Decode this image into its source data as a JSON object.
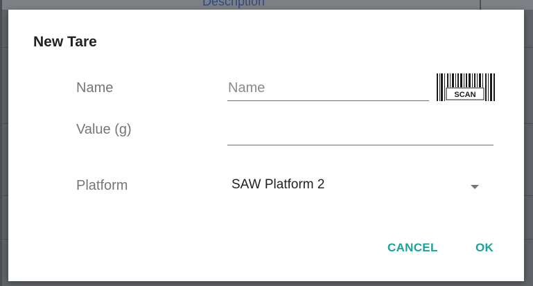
{
  "background": {
    "header_text": "Description"
  },
  "dialog": {
    "title": "New Tare",
    "fields": {
      "name": {
        "label": "Name",
        "value": "",
        "placeholder": "Name"
      },
      "value": {
        "label": "Value (g)",
        "value": "",
        "placeholder": ""
      },
      "platform": {
        "label": "Platform",
        "selected": "SAW Platform 2"
      }
    },
    "scan_button": {
      "label": "SCAN",
      "icon": "barcode-scan-icon"
    },
    "actions": {
      "cancel_label": "CANCEL",
      "ok_label": "OK"
    }
  },
  "colors": {
    "accent": "#1aa39a",
    "label_gray": "#757575",
    "backdrop": "#5f6266"
  }
}
